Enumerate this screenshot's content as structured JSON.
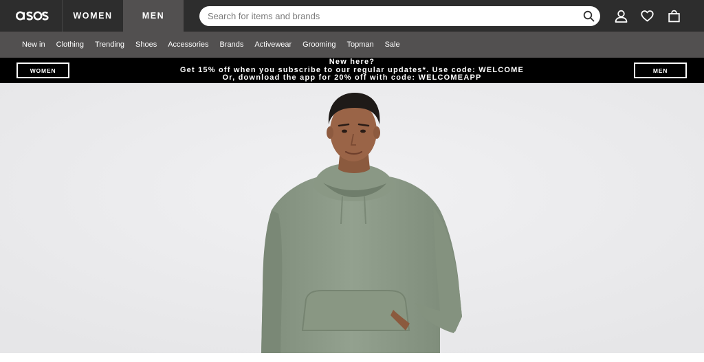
{
  "header": {
    "logo_text": "asos",
    "tabs": [
      {
        "label": "WOMEN",
        "active": false
      },
      {
        "label": "MEN",
        "active": true
      }
    ],
    "search": {
      "placeholder": "Search for items and brands",
      "icon": "search-icon"
    },
    "icons": [
      "account-icon",
      "heart-icon",
      "bag-icon"
    ]
  },
  "nav": {
    "items": [
      "New in",
      "Clothing",
      "Trending",
      "Shoes",
      "Accessories",
      "Brands",
      "Activewear",
      "Grooming",
      "Topman",
      "Sale"
    ]
  },
  "promo": {
    "women_button": "WOMEN",
    "men_button": "MEN",
    "line1": "New here?",
    "line2": "Get 15% off when you subscribe to our regular updates*. Use code: WELCOME",
    "line3": "Or, download the app for 20% off with code: WELCOMEAPP"
  },
  "colors": {
    "header_bg": "#2d2d2d",
    "nav_bg": "#525050",
    "active_tab_bg": "#525050",
    "promo_bg": "#000000",
    "hero_bg": "#ebebed",
    "hoodie": "#8c9a88"
  },
  "hero": {
    "image": "man-wearing-sage-green-hoodie"
  }
}
